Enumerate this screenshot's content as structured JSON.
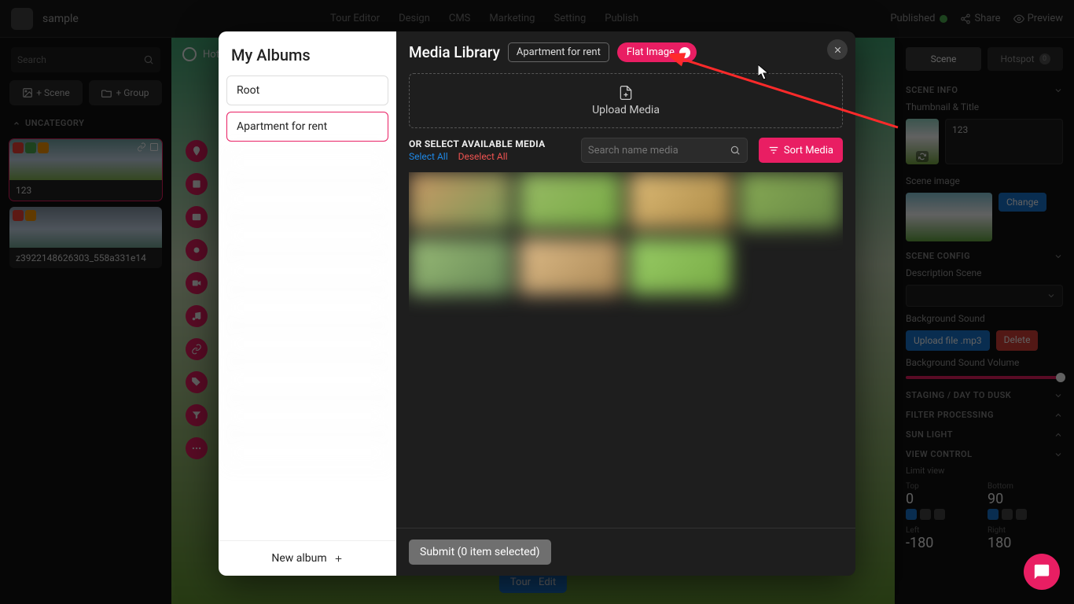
{
  "topbar": {
    "file": "sample",
    "tabs": [
      "Tour Editor",
      "Design",
      "CMS",
      "Marketing",
      "Setting",
      "Publish"
    ],
    "published": "Published",
    "share": "Share",
    "preview": "Preview"
  },
  "left": {
    "search_ph": "Search",
    "add_scene": "+ Scene",
    "add_group": "+ Group",
    "category": "UNCATEGORY",
    "cards": [
      {
        "label": "123"
      },
      {
        "label": "z3922148626303_558a331e14"
      }
    ]
  },
  "center": {
    "hotspot": "Hotspots",
    "pill": {
      "tour": "Tour",
      "edit": "Edit"
    }
  },
  "right": {
    "tabs": {
      "scene": "Scene",
      "hotspot": "Hotspot",
      "badge": "0"
    },
    "scene_info": "SCENE INFO",
    "thumb_title": "Thumbnail & Title",
    "title_value": "123",
    "scene_image": "Scene image",
    "change": "Change",
    "scene_config": "SCENE CONFIG",
    "desc": "Description Scene",
    "bgsound": "Background Sound",
    "upload_mp3": "Upload file .mp3",
    "delete": "Delete",
    "bgvol": "Background Sound Volume",
    "staging": "STAGING / DAY TO DUSK",
    "filter": "FILTER PROCESSING",
    "sunlight": "SUN LIGHT",
    "viewctrl": "VIEW CONTROL",
    "limit": "Limit view",
    "nums": {
      "top_l": "Top",
      "top_v": "0",
      "bot_l": "Bottom",
      "bot_v": "90",
      "left_l": "Left",
      "left_v": "-180",
      "right_l": "Right",
      "right_v": "180"
    }
  },
  "modal": {
    "albums_title": "My Albums",
    "albums": [
      "Root",
      "Apartment for rent"
    ],
    "new_album": "New album",
    "lib_title": "Media Library",
    "crumb": "Apartment for rent",
    "flat": "Flat Image",
    "upload": "Upload Media",
    "or_select": "OR SELECT AVAILABLE MEDIA",
    "select_all": "Select All",
    "deselect_all": "Deselect All",
    "search_ph": "Search name media",
    "sort": "Sort Media",
    "submit": "Submit (0 item selected)"
  }
}
